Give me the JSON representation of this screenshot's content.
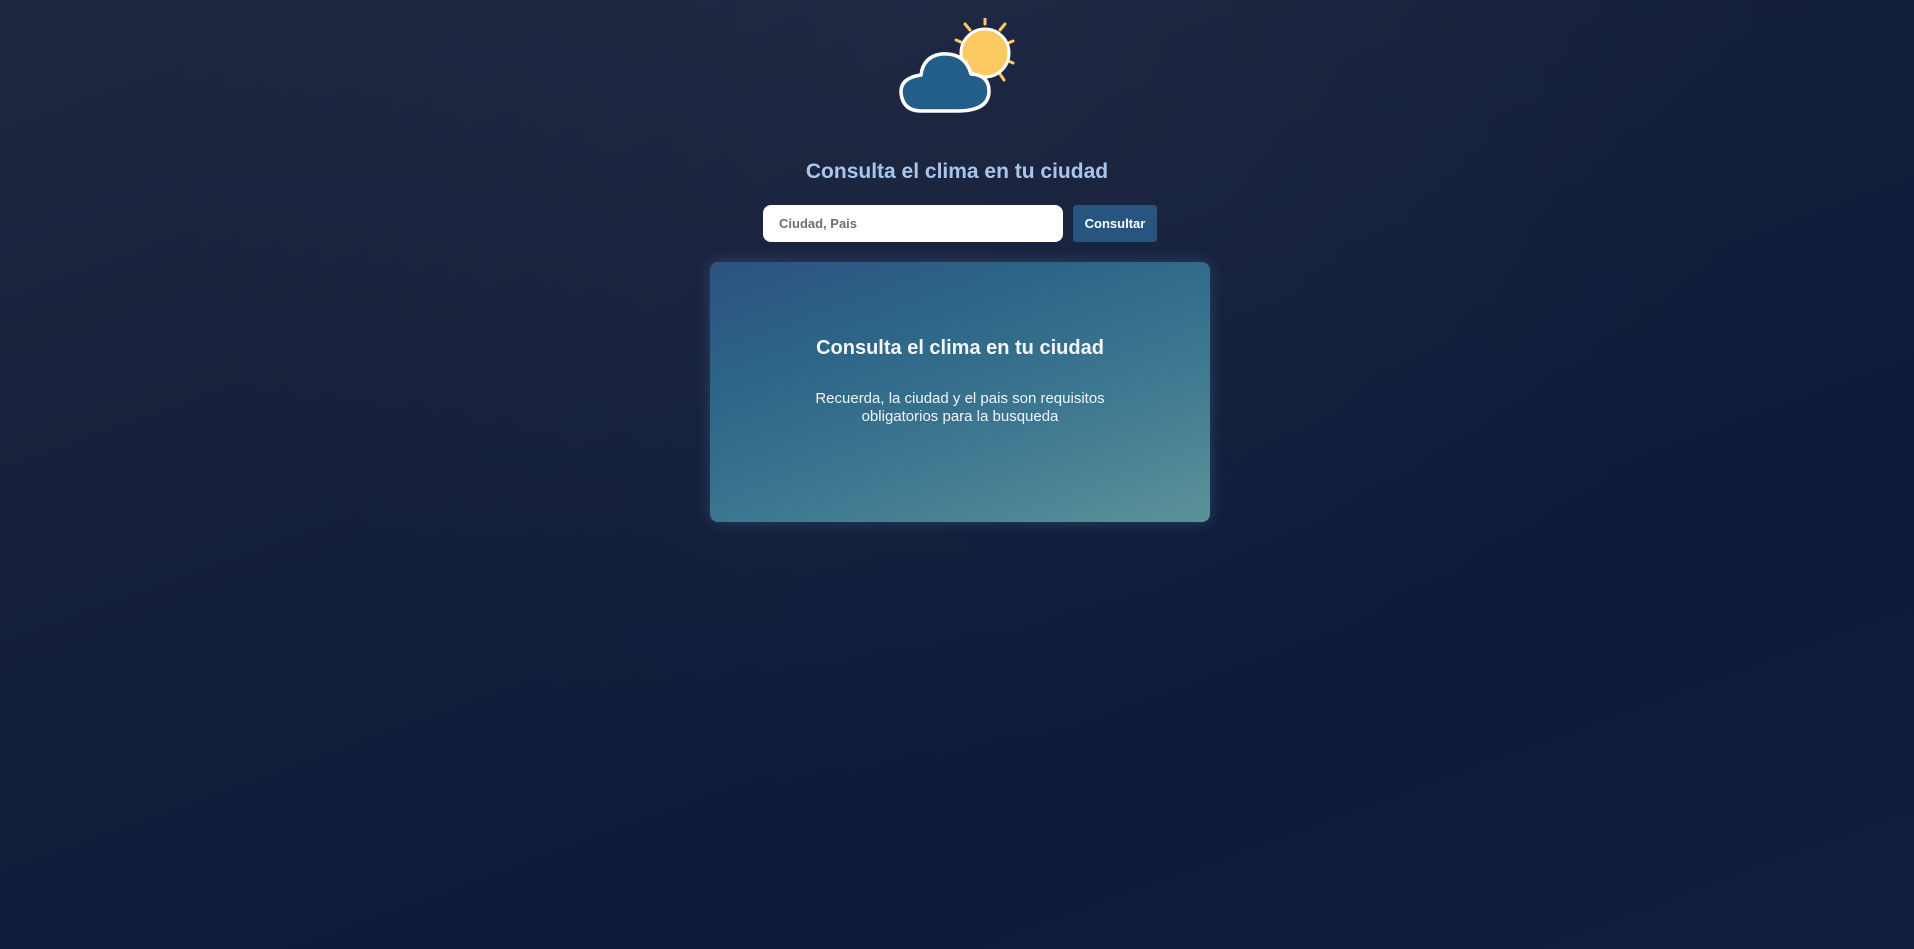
{
  "logo": {
    "icon": "partly-cloudy-icon",
    "cloud_color": "#235e8b",
    "sun_color": "#fdc962"
  },
  "header": {
    "title": "Consulta el clima en tu ciudad"
  },
  "search": {
    "placeholder": "Ciudad, Pais",
    "value": "",
    "button_label": "Consultar"
  },
  "card": {
    "title": "Consulta el clima en tu ciudad",
    "message": "Recuerda, la ciudad y el pais son requisitos obligatorios para la busqueda"
  },
  "colors": {
    "accent": "#27557f",
    "title": "#a9c5ee",
    "background": "#16203a"
  }
}
